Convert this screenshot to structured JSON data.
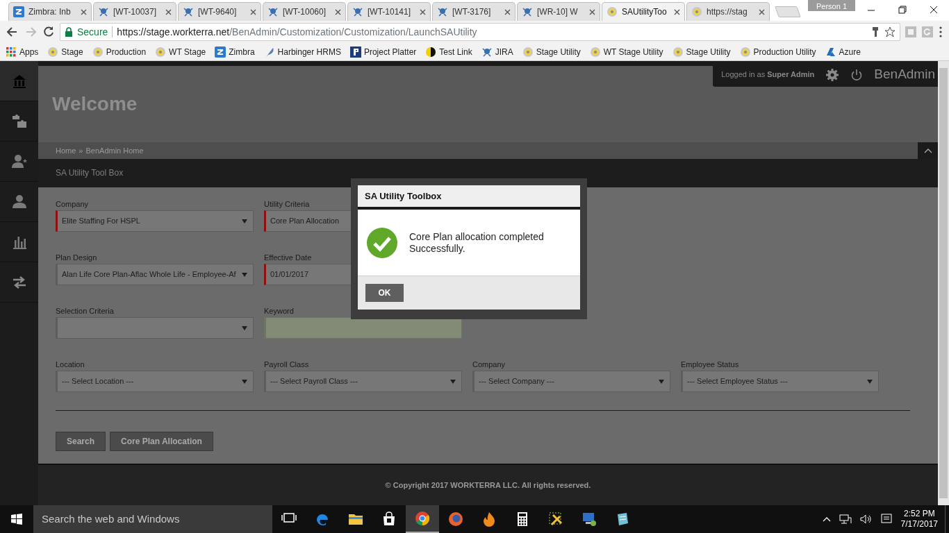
{
  "browser": {
    "tabs": [
      {
        "title": "Zimbra: Inb",
        "kind": "zimbra",
        "selected": false
      },
      {
        "title": "[WT-10037]",
        "kind": "jira",
        "selected": false
      },
      {
        "title": "[WT-9640]",
        "kind": "jira",
        "selected": false
      },
      {
        "title": "[WT-10060]",
        "kind": "jira",
        "selected": false
      },
      {
        "title": "[WT-10141]",
        "kind": "jira",
        "selected": false
      },
      {
        "title": "[WT-3176]",
        "kind": "jira",
        "selected": false
      },
      {
        "title": "[WR-10] W",
        "kind": "jira",
        "selected": false
      },
      {
        "title": "SAUtilityToo",
        "kind": "utility",
        "selected": true
      },
      {
        "title": "https://stag",
        "kind": "utility",
        "selected": false
      }
    ],
    "profile": "Person 1",
    "secure_label": "Secure",
    "url_host": "https://stage.workterra.net",
    "url_path": "/BenAdmin/Customization/Customization/LaunchSAUtility",
    "bookmarks": [
      {
        "label": "Apps",
        "kind": "apps"
      },
      {
        "label": "Stage",
        "kind": "utility"
      },
      {
        "label": "Production",
        "kind": "utility"
      },
      {
        "label": "WT Stage",
        "kind": "utility"
      },
      {
        "label": "Zimbra",
        "kind": "zimbra"
      },
      {
        "label": "Harbinger HRMS",
        "kind": "feather"
      },
      {
        "label": "Project Platter",
        "kind": "platter"
      },
      {
        "label": "Test Link",
        "kind": "testlink"
      },
      {
        "label": "JIRA",
        "kind": "jira"
      },
      {
        "label": "Stage Utility",
        "kind": "utility"
      },
      {
        "label": "WT Stage Utility",
        "kind": "utility"
      },
      {
        "label": "Stage Utility",
        "kind": "utility"
      },
      {
        "label": "Production Utility",
        "kind": "utility"
      },
      {
        "label": "Azure",
        "kind": "azure"
      }
    ]
  },
  "header": {
    "logged_in": "Logged in as **Super Admin**",
    "brand": "BenAdmin",
    "welcome": "Welcome",
    "breadcrumb": [
      "Home",
      "BenAdmin Home"
    ],
    "breadcrumb_separator": "»"
  },
  "page_title": "SA Utility Tool Box",
  "form": {
    "rows": [
      [
        {
          "label": "Company",
          "kind": "select",
          "value": "Elite Staffing For HSPL",
          "required": true
        },
        {
          "label": "Utility Criteria",
          "kind": "covered-select",
          "value": "Core Plan Allocation",
          "required": true
        }
      ],
      [
        {
          "label": "Plan Design",
          "kind": "select",
          "value": "Alan Life Core Plan-Aflac Whole Life - Employee-Af",
          "required": false
        },
        {
          "label": "Effective Date",
          "kind": "text",
          "value": "01/01/2017",
          "required": true
        }
      ],
      [
        {
          "label": "Selection Criteria",
          "kind": "select",
          "required": false
        },
        {
          "label": "Keyword",
          "kind": "text",
          "required": false,
          "disabled": true
        }
      ],
      [
        {
          "label": "Location",
          "kind": "select",
          "value": "--- Select Location ---",
          "required": false
        },
        {
          "label": "Payroll Class",
          "kind": "select",
          "value": "--- Select Payroll Class ---",
          "required": false
        },
        {
          "label": "Company",
          "kind": "select",
          "value": "--- Select Company ---",
          "required": false
        },
        {
          "label": "Employee Status",
          "kind": "select",
          "value": "--- Select Employee Status ---",
          "required": false
        }
      ]
    ],
    "buttons": [
      "Search",
      "Core Plan Allocation"
    ]
  },
  "footer": {
    "copyright": "© Copyright 2017 WORKTERRA LLC. All rights reserved."
  },
  "dialog": {
    "title": "SA Utility Toolbox",
    "message": "Core Plan allocation completed Successfully.",
    "button": "OK"
  },
  "taskbar": {
    "search_placeholder": "Search the web and Windows",
    "apps": [
      {
        "kind": "taskview",
        "selected": false
      },
      {
        "kind": "edge",
        "selected": false
      },
      {
        "kind": "folder",
        "selected": false
      },
      {
        "kind": "store",
        "selected": false
      },
      {
        "kind": "chrome",
        "selected": true
      },
      {
        "kind": "firefox",
        "selected": false
      },
      {
        "kind": "flame",
        "selected": false
      },
      {
        "kind": "calculator",
        "selected": false
      },
      {
        "kind": "tools",
        "selected": false
      },
      {
        "kind": "network",
        "selected": false
      },
      {
        "kind": "notes",
        "selected": false
      }
    ],
    "time": "2:52 PM",
    "date": "7/17/2017"
  }
}
